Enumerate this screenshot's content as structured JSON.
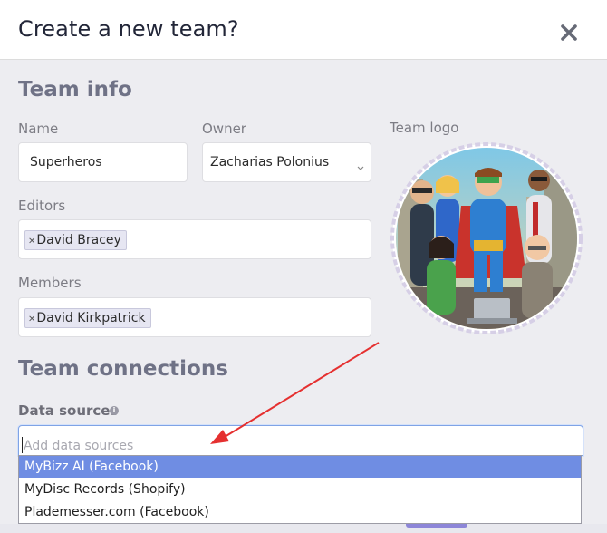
{
  "modal": {
    "title": "Create a new team?",
    "close_icon": "close-icon"
  },
  "team_info": {
    "heading": "Team info",
    "name_label": "Name",
    "name_value": "Superheros",
    "owner_label": "Owner",
    "owner_value": "Zacharias Polonius",
    "editors_label": "Editors",
    "editors": [
      "David Bracey"
    ],
    "members_label": "Members",
    "members": [
      "David Kirkpatrick"
    ],
    "logo_label": "Team logo",
    "logo_image": "cartoon superhero team illustration"
  },
  "team_connections": {
    "heading": "Team connections",
    "data_sources_label": "Data sources",
    "info_icon": "info-icon",
    "input_placeholder": "Add data sources",
    "options": [
      "MyBizz AI (Facebook)",
      "MyDisc Records (Shopify)",
      "Plademesser.com (Facebook)"
    ],
    "highlighted_option": "MyBizz AI (Facebook)"
  },
  "annotation": {
    "arrow_color": "#e53030"
  },
  "colors": {
    "accent": "#6f8de3",
    "heading": "#6f7286",
    "background": "#ededf1"
  }
}
